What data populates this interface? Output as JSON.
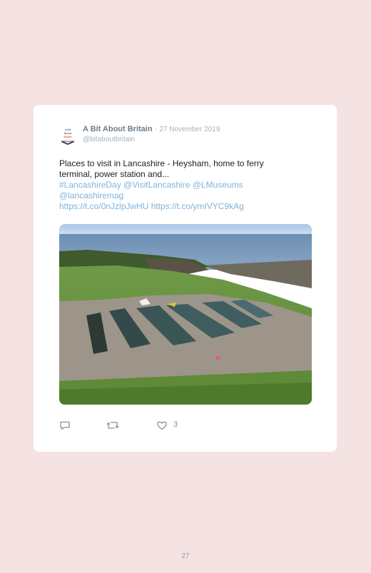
{
  "tweet": {
    "author_name": "A Bit About Britain",
    "separator": "·",
    "date": "27 November 2019",
    "handle": "@bitaboutbritain",
    "text_line": "Places to visit in Lancashire - Heysham, home to ferry terminal, power station and...",
    "links_line1": "#LancashireDay @VisitLancashire @LMuseums",
    "links_line2": "@lancashiremag",
    "links_line3": "https://t.co/0nJzlpJwHU https://t.co/ymIVYC9kAg",
    "like_count": "3"
  },
  "page": {
    "number": "27"
  },
  "icons": [
    "reply-icon",
    "retweet-icon",
    "like-icon"
  ]
}
